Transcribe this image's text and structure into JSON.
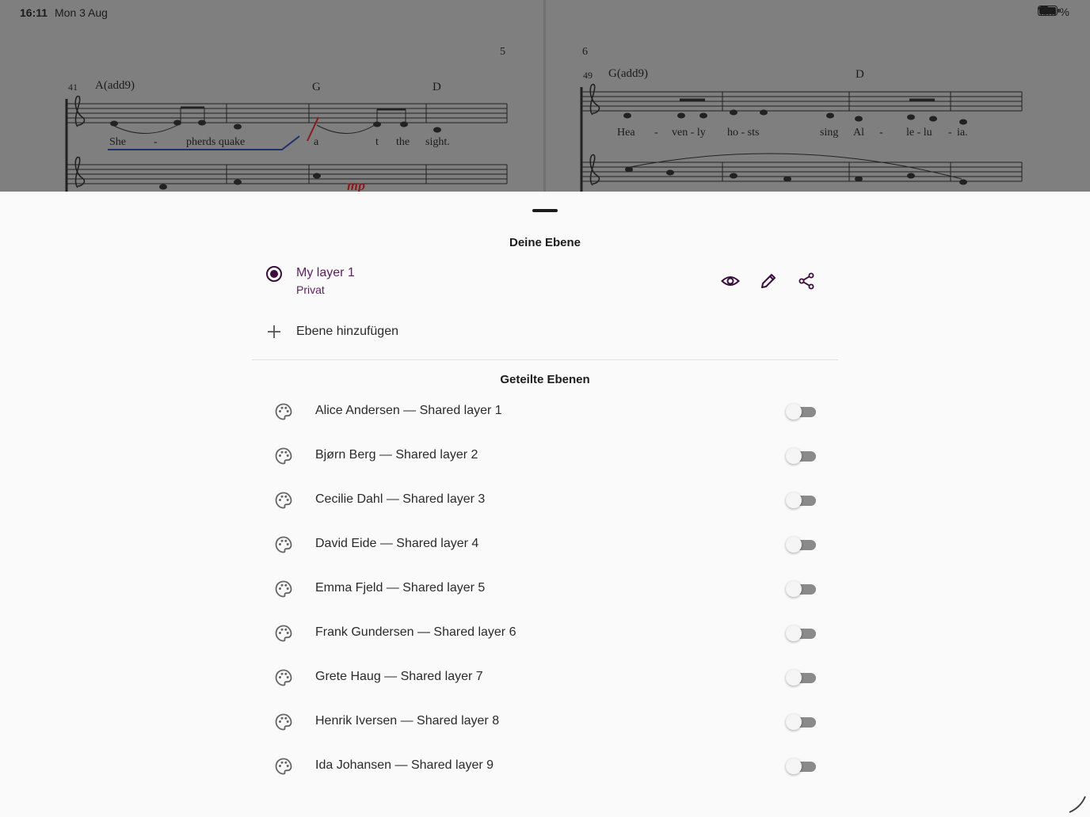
{
  "status_bar": {
    "time": "16:11",
    "date": "Mon 3 Aug",
    "battery": "100 %"
  },
  "score": {
    "page_left": "5",
    "page_right": "6",
    "measure_left": "41",
    "measure_right": "49",
    "chords_left": [
      "A(add9)",
      "G",
      "D"
    ],
    "chords_right": [
      "G(add9)",
      "D"
    ],
    "lyrics_left": [
      "She",
      "-",
      "pherds quake",
      "a",
      "t",
      "the",
      "sight."
    ],
    "lyrics_right": [
      "Hea",
      "-",
      "ven - ly",
      "ho - sts",
      "sing",
      "Al",
      "-",
      "le - lu",
      "-",
      "ia."
    ],
    "dynamic_mark": "mp"
  },
  "sheet": {
    "my_section_title": "Deine Ebene",
    "my_layer": {
      "name": "My layer 1",
      "visibility": "Privat"
    },
    "add_layer_label": "Ebene hinzufügen",
    "shared_section_title": "Geteilte Ebenen",
    "shared_layers": [
      {
        "label": "Alice Andersen — Shared layer 1",
        "enabled": false
      },
      {
        "label": "Bjørn Berg — Shared layer 2",
        "enabled": false
      },
      {
        "label": "Cecilie Dahl — Shared layer 3",
        "enabled": false
      },
      {
        "label": "David Eide — Shared layer 4",
        "enabled": false
      },
      {
        "label": "Emma Fjeld — Shared layer 5",
        "enabled": false
      },
      {
        "label": "Frank Gundersen — Shared layer 6",
        "enabled": false
      },
      {
        "label": "Grete Haug — Shared layer 7",
        "enabled": false
      },
      {
        "label": "Henrik Iversen — Shared layer 8",
        "enabled": false
      },
      {
        "label": "Ida Johansen — Shared layer 9",
        "enabled": false
      }
    ]
  },
  "icons": {
    "layer_actions": [
      "eye-icon",
      "pencil-icon",
      "share-icon"
    ],
    "shared_row_icon": "palette-icon"
  },
  "colors": {
    "accent": "#3a0d3e",
    "accent_text": "#5a1f5f",
    "annotation_blue": "#1f2f6e",
    "annotation_red": "#8a1c1c"
  }
}
